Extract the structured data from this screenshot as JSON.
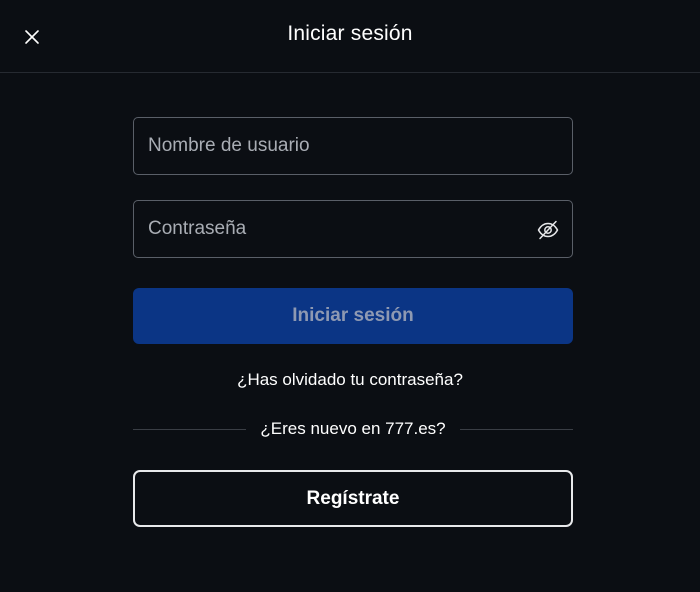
{
  "header": {
    "title": "Iniciar sesión",
    "close_icon": "close-icon"
  },
  "form": {
    "username_placeholder": "Nombre de usuario",
    "username_value": "",
    "password_placeholder": "Contraseña",
    "password_value": "",
    "password_toggle_icon": "eye-off-icon",
    "submit_label": "Iniciar sesión"
  },
  "links": {
    "forgot_password": "¿Has olvidado tu contraseña?"
  },
  "signup": {
    "prompt": "¿Eres nuevo en 777.es?",
    "register_label": "Regístrate"
  },
  "colors": {
    "background": "#0b0e13",
    "primary_button": "#0b3585",
    "primary_button_text": "#8e99b2",
    "field_border": "#5a5f68",
    "text": "#ffffff"
  }
}
